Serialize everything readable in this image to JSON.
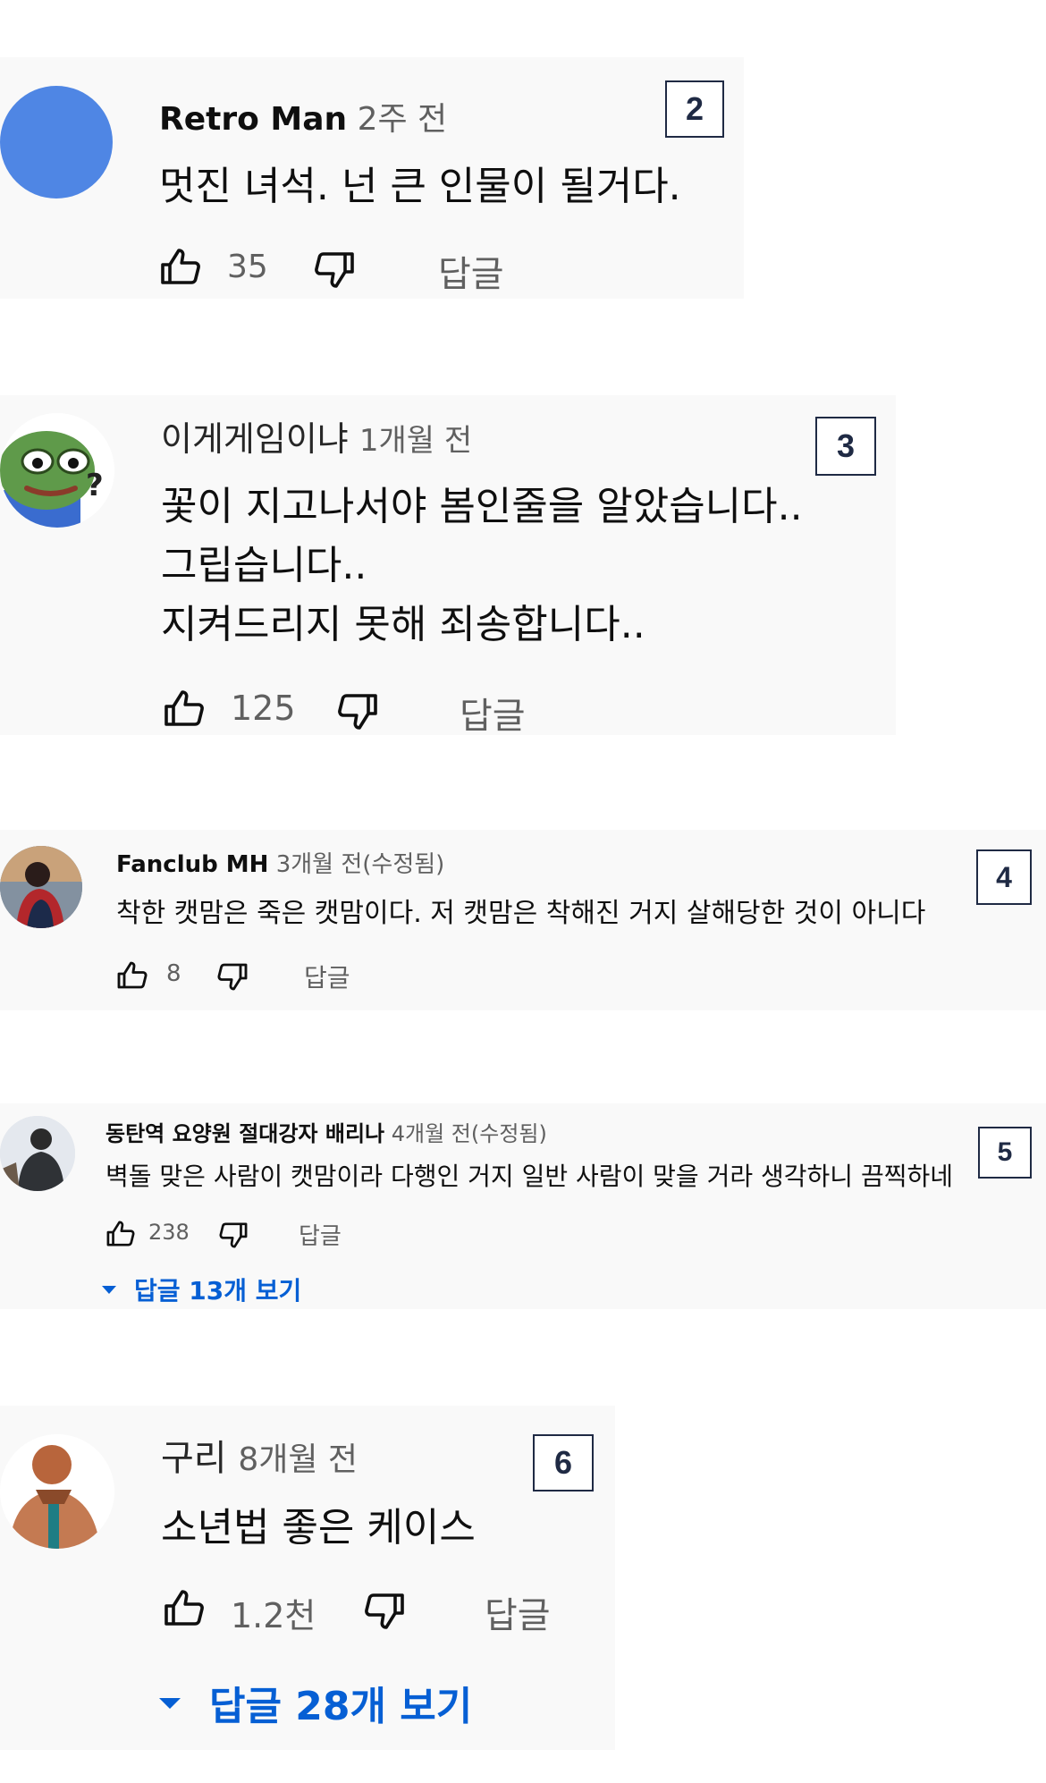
{
  "comments": [
    {
      "author": "Retro Man",
      "time": "2주 전",
      "lines": [
        "멋진 녀석. 넌 큰 인물이 될거다."
      ],
      "likes": "35",
      "reply_label": "답글",
      "badge": "2",
      "avatar_color": "#4f86e4"
    },
    {
      "author": "이게게임이냐",
      "time": "1개월 전",
      "lines": [
        "꽃이 지고나서야 봄인줄을 알았습니다..",
        "그립습니다..",
        "지켜드리지 못해 죄송합니다.."
      ],
      "likes": "125",
      "reply_label": "답글",
      "badge": "3"
    },
    {
      "author": "Fanclub MH",
      "time": "3개월 전(수정됨)",
      "lines": [
        "착한 캣맘은 죽은 캣맘이다. 저 캣맘은 착해진 거지 살해당한 것이 아니다"
      ],
      "likes": "8",
      "reply_label": "답글",
      "badge": "4"
    },
    {
      "author": "동탄역 요양원 절대강자 배리나",
      "time": "4개월 전(수정됨)",
      "lines": [
        "벽돌 맞은 사람이 캣맘이라 다행인 거지 일반 사람이 맞을 거라 생각하니 끔찍하네"
      ],
      "likes": "238",
      "reply_label": "답글",
      "view_replies": "답글 13개 보기",
      "badge": "5"
    },
    {
      "author": "구리",
      "time": "8개월 전",
      "lines": [
        "소년법 좋은 케이스"
      ],
      "likes": "1.2천",
      "reply_label": "답글",
      "view_replies": "답글 28개 보기",
      "badge": "6"
    }
  ],
  "icons": {
    "like": "thumbs-up-icon",
    "dislike": "thumbs-down-icon",
    "expand": "caret-down-icon"
  },
  "colors": {
    "card_bg": "#f9f9f9",
    "link_blue": "#065fd4",
    "badge_border": "#1f2a44"
  }
}
